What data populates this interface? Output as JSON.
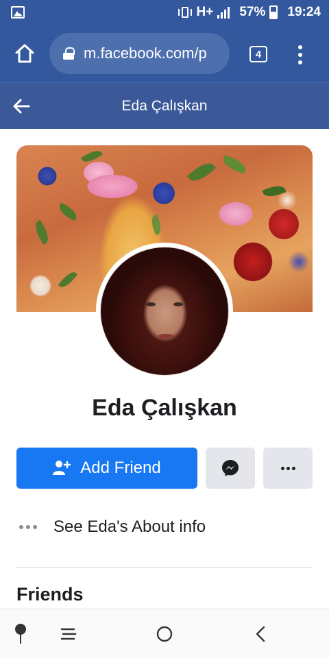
{
  "status_bar": {
    "network": "H+",
    "battery": "57%",
    "time": "19:24"
  },
  "browser": {
    "url": "m.facebook.com/p",
    "tab_count": "4"
  },
  "header": {
    "title": "Eda Çalışkan"
  },
  "profile": {
    "name": "Eda Çalışkan",
    "add_friend_label": "Add Friend",
    "about_label": "See Eda's About info",
    "friends_heading": "Friends"
  },
  "colors": {
    "status_bar_bg": "#34589d",
    "header_bg": "#3b5998",
    "primary_button": "#1877f2",
    "secondary_button": "#e4e6eb"
  },
  "icons": {
    "status_left": "image-icon",
    "browser_home": "home-icon",
    "secure": "lock-icon",
    "back": "back-arrow-icon",
    "add_friend": "add-person-icon",
    "messenger": "messenger-icon",
    "more": "more-dots-icon",
    "about": "dots-icon",
    "nav": [
      "pin-icon",
      "menu-icon",
      "home-circle-icon",
      "back-chevron-icon"
    ]
  }
}
